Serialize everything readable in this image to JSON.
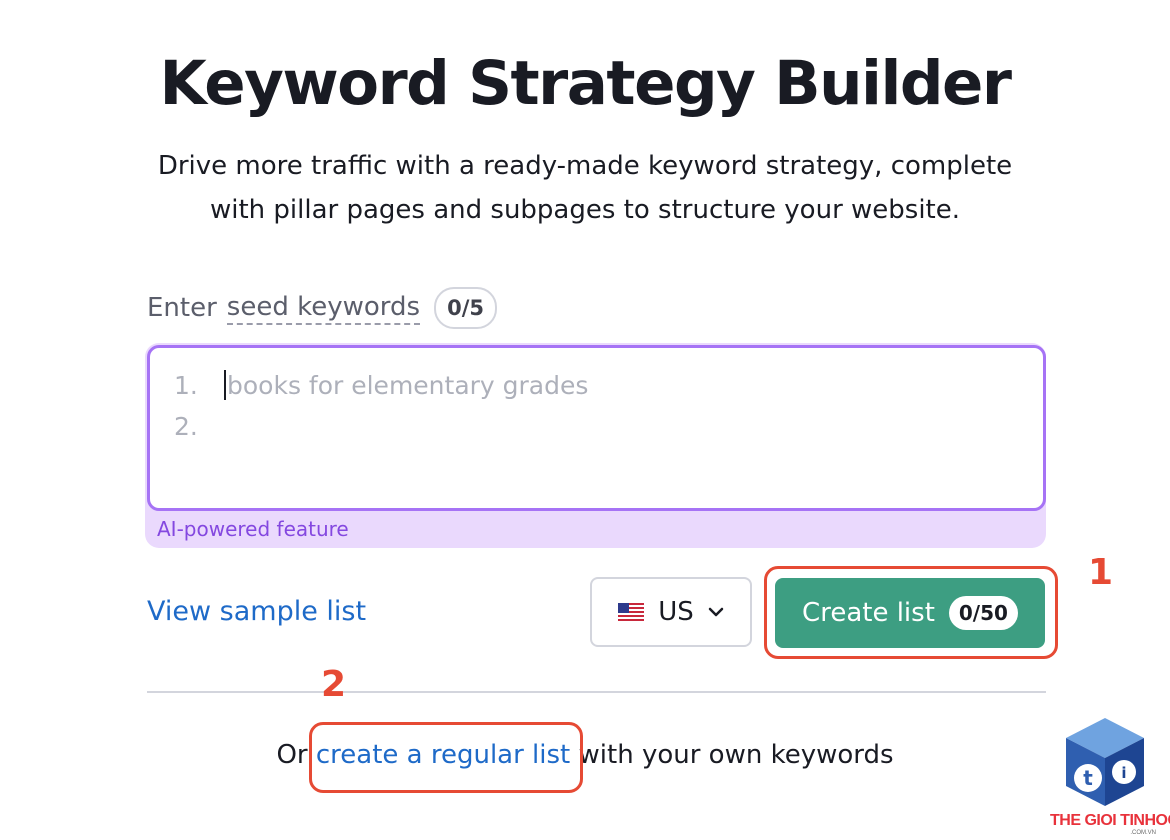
{
  "page": {
    "title": "Keyword Strategy Builder",
    "subtitle_line1": "Drive more traffic with a ready-made keyword strategy, complete",
    "subtitle_line2": "with pillar pages and subpages to structure your website."
  },
  "seed": {
    "label_prefix": "Enter",
    "label_link": "seed keywords",
    "counter": "0/5",
    "lines": [
      {
        "number": "1.",
        "placeholder": "books for elementary grades"
      },
      {
        "number": "2.",
        "placeholder": ""
      }
    ],
    "ai_label": "AI-powered feature"
  },
  "actions": {
    "view_sample": "View sample list",
    "country": "US",
    "country_flag_icon": "us-flag-icon",
    "create_label": "Create list",
    "create_counter": "0/50",
    "create_color": "#3d9e82"
  },
  "footer": {
    "prefix": "Or",
    "link": "create a regular list",
    "suffix": "with your own keywords"
  },
  "annotations": {
    "marker1": "1",
    "marker2": "2",
    "color": "#e64a34"
  },
  "watermark": {
    "brand": "THE GIOI TINHOC",
    "domain": ".COM.VN"
  }
}
